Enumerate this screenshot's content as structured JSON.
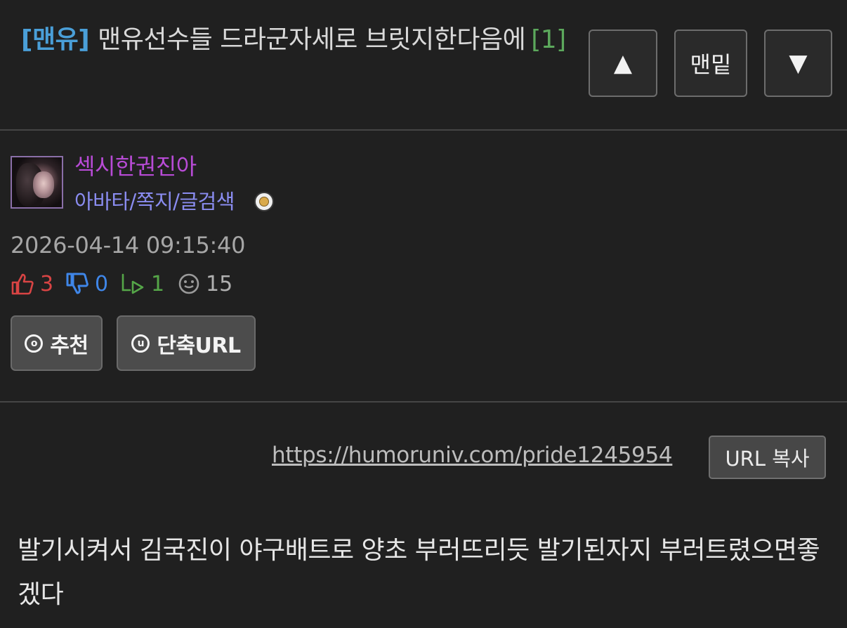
{
  "header": {
    "category": "[맨유]",
    "title": "맨유선수들 드라군자세로 브릿지한다음에",
    "comment_count": "[1]"
  },
  "nav": {
    "up_label": "▲",
    "bottom_label": "맨밑",
    "down_label": "▼"
  },
  "author": {
    "nickname": "섹시한권진아",
    "links": "아바타/쪽지/글검색"
  },
  "post": {
    "datetime": "2026-04-14 09:15:40",
    "likes": "3",
    "dislikes": "0",
    "replies": "1",
    "views": "15",
    "url": "https://humoruniv.com/pride1245954",
    "body": "발기시켜서 김국진이 야구배트로 양초 부러뜨리듯 발기된자지 부러트렸으면좋겠다"
  },
  "actions": {
    "recommend_icon": "ⓞ",
    "recommend_label": "추천",
    "short_url_icon": "u",
    "short_url_label": "단축URL",
    "copy_url_label": "URL 복사"
  },
  "colors": {
    "background": "#202020",
    "category": "#4a9fd8",
    "comment_count": "#5ca85c",
    "nickname": "#b84bd6",
    "user_links": "#8a8cf0",
    "like": "#d84444",
    "dislike": "#3f86e8",
    "reply": "#55a648"
  }
}
